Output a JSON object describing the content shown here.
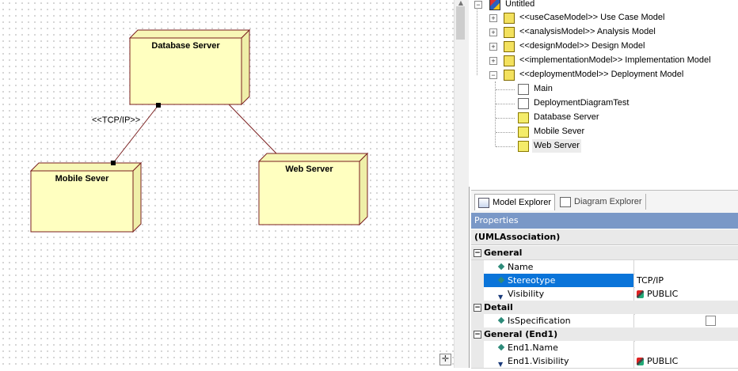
{
  "diagram": {
    "nodes": {
      "database_server": "Database Server",
      "mobile_server": "Mobile Sever",
      "web_server": "Web Server"
    },
    "connection_label": "<<TCP/IP>>"
  },
  "tree": {
    "root": "Untitled",
    "models": [
      "<<useCaseModel>> Use Case Model",
      "<<analysisModel>> Analysis Model",
      "<<designModel>> Design Model",
      "<<implementationModel>> Implementation Model",
      "<<deploymentModel>> Deployment Model"
    ],
    "deployment_children": [
      "Main",
      "DeploymentDiagramTest",
      "Database Server",
      "Mobile Sever",
      "Web Server"
    ]
  },
  "tabs": {
    "model_explorer": "Model Explorer",
    "diagram_explorer": "Diagram Explorer"
  },
  "properties": {
    "header": "Properties",
    "element_type": "(UMLAssociation)",
    "categories": {
      "general": "General",
      "detail": "Detail",
      "general_end1": "General (End1)"
    },
    "rows": {
      "name": {
        "label": "Name",
        "value": ""
      },
      "stereotype": {
        "label": "Stereotype",
        "value": "TCP/IP"
      },
      "visibility": {
        "label": "Visibility",
        "value": "PUBLIC"
      },
      "is_specification": {
        "label": "IsSpecification",
        "value": ""
      },
      "end1_name": {
        "label": "End1.Name",
        "value": ""
      },
      "end1_visibility": {
        "label": "End1.Visibility",
        "value": "PUBLIC"
      }
    }
  },
  "colors": {
    "node_fill": "#ffffc0",
    "node_side": "#efefa8",
    "node_border": "#7a1f1f",
    "selection": "#0a74d9",
    "properties_header": "#7a98c7"
  }
}
